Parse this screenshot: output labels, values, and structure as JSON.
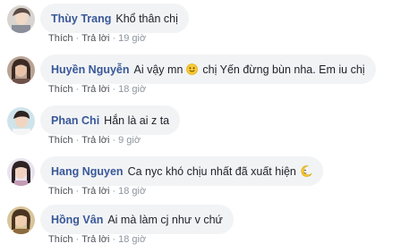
{
  "comments": [
    {
      "author": "Thùy Trang",
      "text": "Khổ thân chị",
      "like_label": "Thích",
      "reply_label": "Trả lời",
      "time": "19 giờ"
    },
    {
      "author": "Huyền Nguyễn",
      "text_before_emoji": "Ai vậy mn",
      "emoji": "smiling-face-icon",
      "text_after_emoji": "chị Yến đừng bùn nha. Em iu chị",
      "like_label": "Thích",
      "reply_label": "Trả lời",
      "time": "18 giờ"
    },
    {
      "author": "Phan Chi",
      "text": "Hắn là ai z ta",
      "like_label": "Thích",
      "reply_label": "Trả lời",
      "time": "9 giờ"
    },
    {
      "author": "Hang Nguyen",
      "text": "Ca nyc khó chịu nhất đã xuất hiện",
      "emoji": "moon-face-icon",
      "like_label": "Thích",
      "reply_label": "Trả lời",
      "time": "18 giờ"
    },
    {
      "author": "Hồng Vân",
      "text": "Ai mà làm cj như v chứ",
      "like_label": "Thích",
      "reply_label": "Trả lời",
      "time": "18 giờ"
    }
  ],
  "colors": {
    "author": "#385898",
    "bubble": "#f2f3f5",
    "meta": "#606770"
  }
}
